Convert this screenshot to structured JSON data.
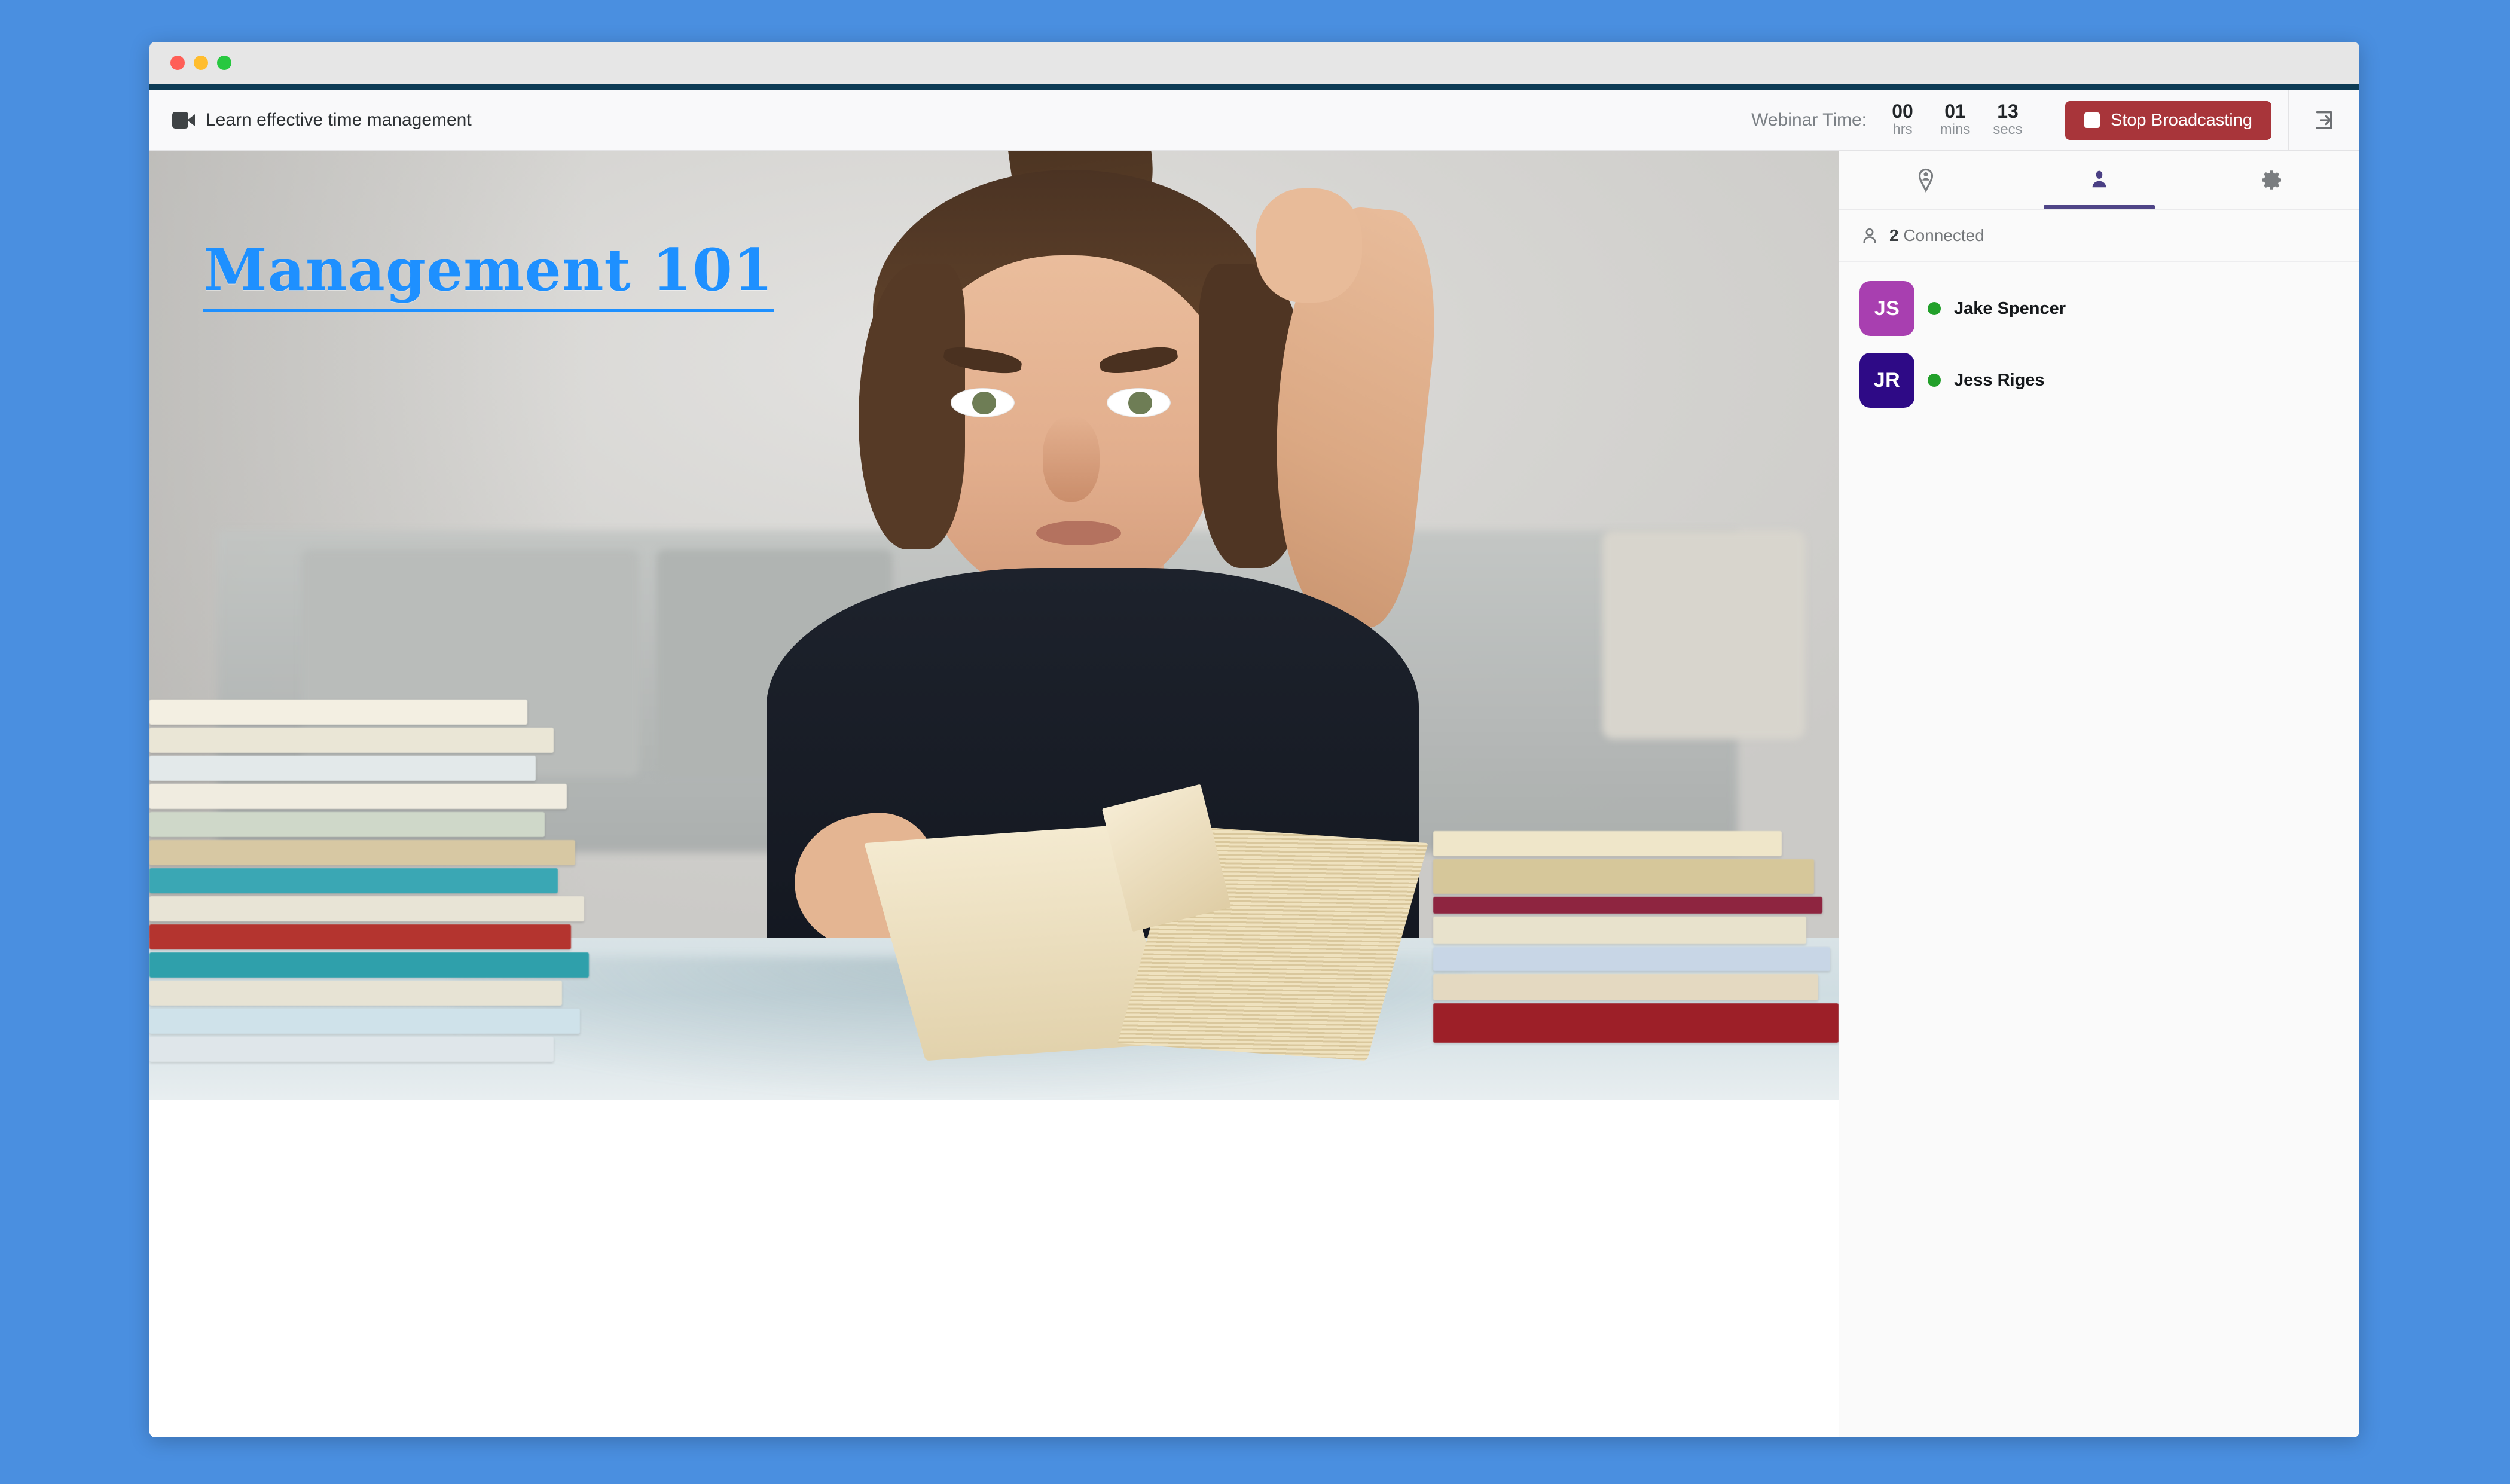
{
  "theme": {
    "page_background": "#4a8fe0",
    "accent_navy": "#0d3b55",
    "danger": "#a8353a",
    "tab_active": "#4f4587",
    "online": "#22a02a",
    "slide_title_color": "#1e90ff"
  },
  "window_controls": {
    "close": "close-button",
    "minimize": "minimize-button",
    "maximize": "maximize-button"
  },
  "header": {
    "camera_icon": "videocam-icon",
    "session_title": "Learn effective time management",
    "timer": {
      "label": "Webinar Time:",
      "hours_value": "00",
      "hours_unit": "hrs",
      "minutes_value": "01",
      "minutes_unit": "mins",
      "seconds_value": "13",
      "seconds_unit": "secs"
    },
    "stop_broadcasting_label": "Stop Broadcasting",
    "exit_icon": "exit-to-app-icon"
  },
  "stage": {
    "slide_title": "Management 101",
    "slide_description": "Woman studying at a glass table surrounded by stacks of books, one hand pulling her hair in frustration"
  },
  "sidebar": {
    "tabs": [
      {
        "id": "tab-profile",
        "icon": "account-circle-icon",
        "active": false
      },
      {
        "id": "tab-participants",
        "icon": "person-icon",
        "active": true
      },
      {
        "id": "tab-settings",
        "icon": "gear-icon",
        "active": false
      }
    ],
    "connected": {
      "icon": "person-outline-icon",
      "count": "2",
      "label": "Connected"
    },
    "participants": [
      {
        "initials": "JS",
        "name": "Jake Spencer",
        "avatar_color": "#a83fb0",
        "status_color": "#22a02a"
      },
      {
        "initials": "JR",
        "name": "Jess Riges",
        "avatar_color": "#2e0a86",
        "status_color": "#22a02a"
      }
    ]
  }
}
